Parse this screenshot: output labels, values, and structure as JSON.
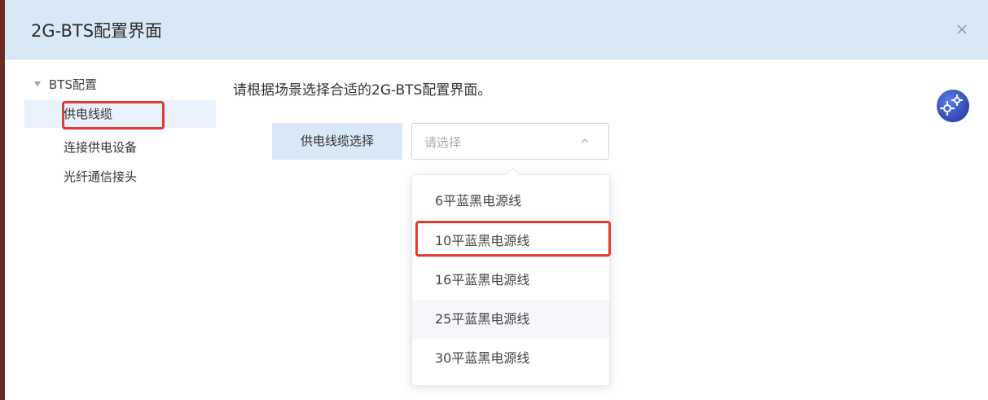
{
  "dialog": {
    "title": "2G-BTS配置界面",
    "close_label": "×"
  },
  "tree": {
    "root_label": "BTS配置",
    "items": [
      {
        "label": "供电线缆",
        "selected": true
      },
      {
        "label": "连接供电设备",
        "selected": false
      },
      {
        "label": "光纤通信接头",
        "selected": false
      }
    ]
  },
  "main": {
    "instruction": "请根据场景选择合适的2G-BTS配置界面。",
    "field_label": "供电线缆选择",
    "select_placeholder": "请选择",
    "options": [
      {
        "label": "6平蓝黑电源线"
      },
      {
        "label": "10平蓝黑电源线",
        "highlighted": true
      },
      {
        "label": "16平蓝黑电源线"
      },
      {
        "label": "25平蓝黑电源线",
        "hover": true
      },
      {
        "label": "30平蓝黑电源线"
      }
    ]
  },
  "icons": {
    "close": "close-icon",
    "chevron": "chevron-up-icon",
    "caret": "caret-down-icon",
    "gear": "gear-icon"
  },
  "colors": {
    "header_bg": "#d8e8f7",
    "selected_bg": "#e9f2fc",
    "highlight_red": "#e23b32",
    "gear_blue": "#3a56c4"
  }
}
